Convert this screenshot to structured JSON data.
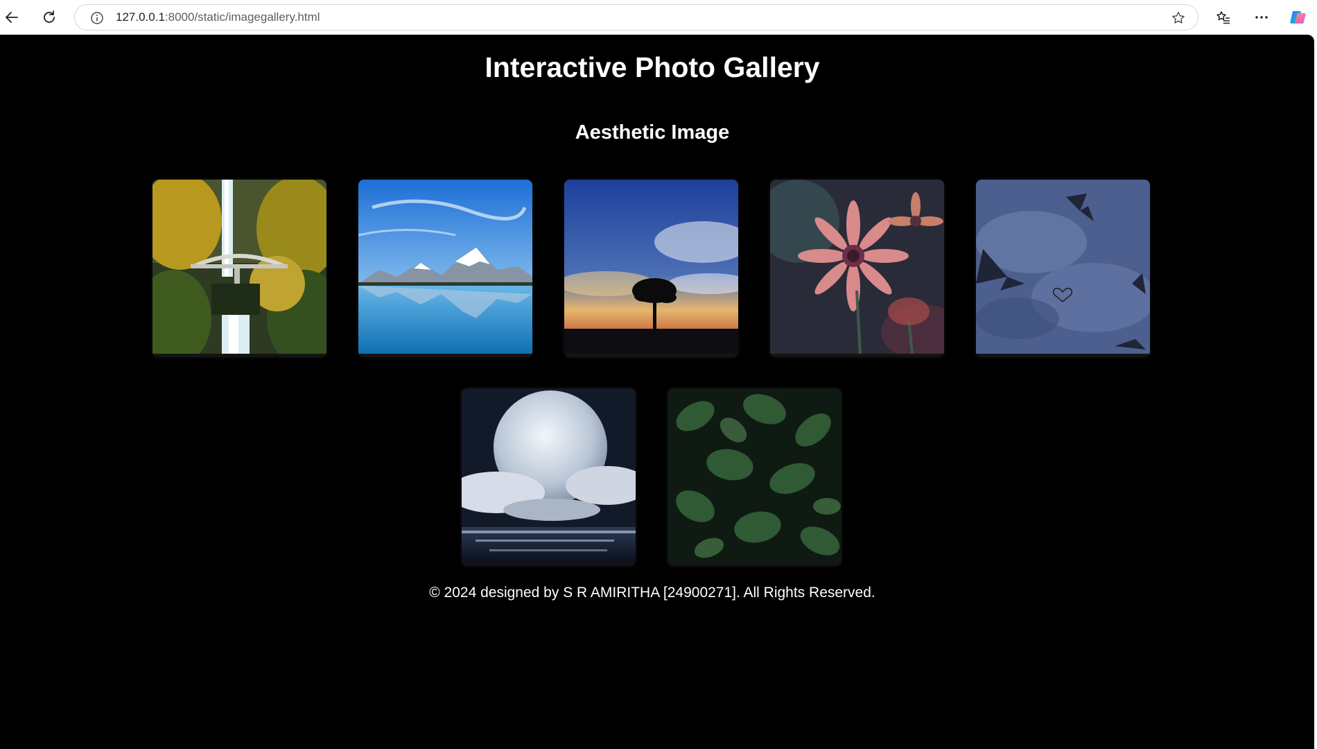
{
  "browser": {
    "url_host": "127.0.0.1",
    "url_rest": ":8000/static/imagegallery.html",
    "icons": [
      "back-arrow-icon",
      "reload-icon",
      "info-icon",
      "star-icon",
      "favorites-icon",
      "more-icon",
      "copilot-icon"
    ]
  },
  "page": {
    "title": "Interactive Photo Gallery",
    "section_title": "Aesthetic Image",
    "footer": "© 2024 designed by S R AMIRITHA [24900271]. All Rights Reserved."
  },
  "gallery": [
    {
      "name": "waterfall-bridge"
    },
    {
      "name": "mountain-lake"
    },
    {
      "name": "sunset-tree"
    },
    {
      "name": "pink-daisies"
    },
    {
      "name": "butterflies-sky"
    },
    {
      "name": "full-moon-ocean"
    },
    {
      "name": "green-leaves"
    }
  ],
  "colors": {
    "page_background": "#000000",
    "text": "#ffffff",
    "card_background": "#141414"
  }
}
